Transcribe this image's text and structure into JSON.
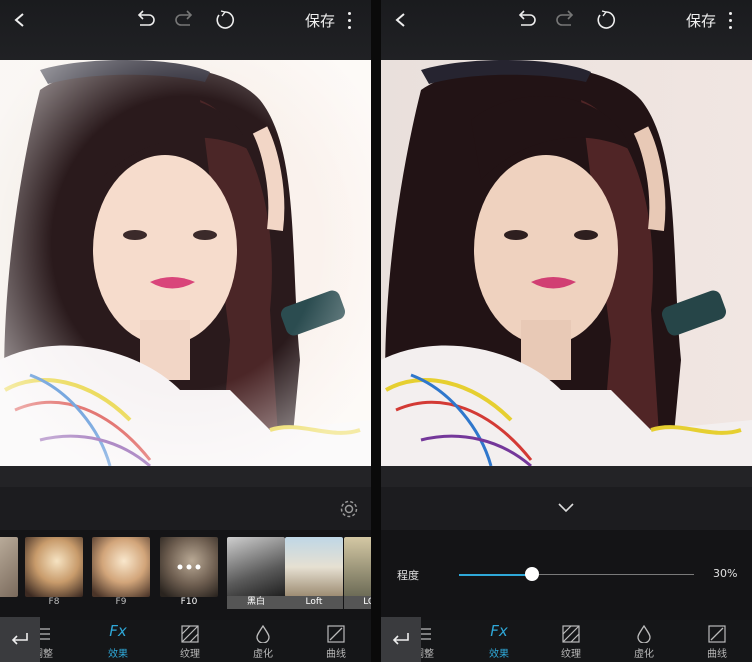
{
  "left_screen": {
    "save_label": "保存",
    "filters": [
      {
        "label": "F8"
      },
      {
        "label": "F9"
      },
      {
        "label": "F10"
      },
      {
        "label": "黑白"
      },
      {
        "label": "Loft"
      },
      {
        "label": "LOM"
      }
    ]
  },
  "right_screen": {
    "save_label": "保存",
    "slider": {
      "label": "程度",
      "value_text": "30%",
      "level": 0.3
    }
  },
  "tabs": [
    {
      "label": "调整",
      "icon": "sliders-icon"
    },
    {
      "label": "效果",
      "icon": "fx-icon",
      "glyph": "Fx"
    },
    {
      "label": "纹理",
      "icon": "texture-icon"
    },
    {
      "label": "虚化",
      "icon": "droplet-icon"
    },
    {
      "label": "曲线",
      "icon": "curve-icon"
    }
  ],
  "colors": {
    "accent": "#2fa8d8",
    "background": "#141416"
  }
}
